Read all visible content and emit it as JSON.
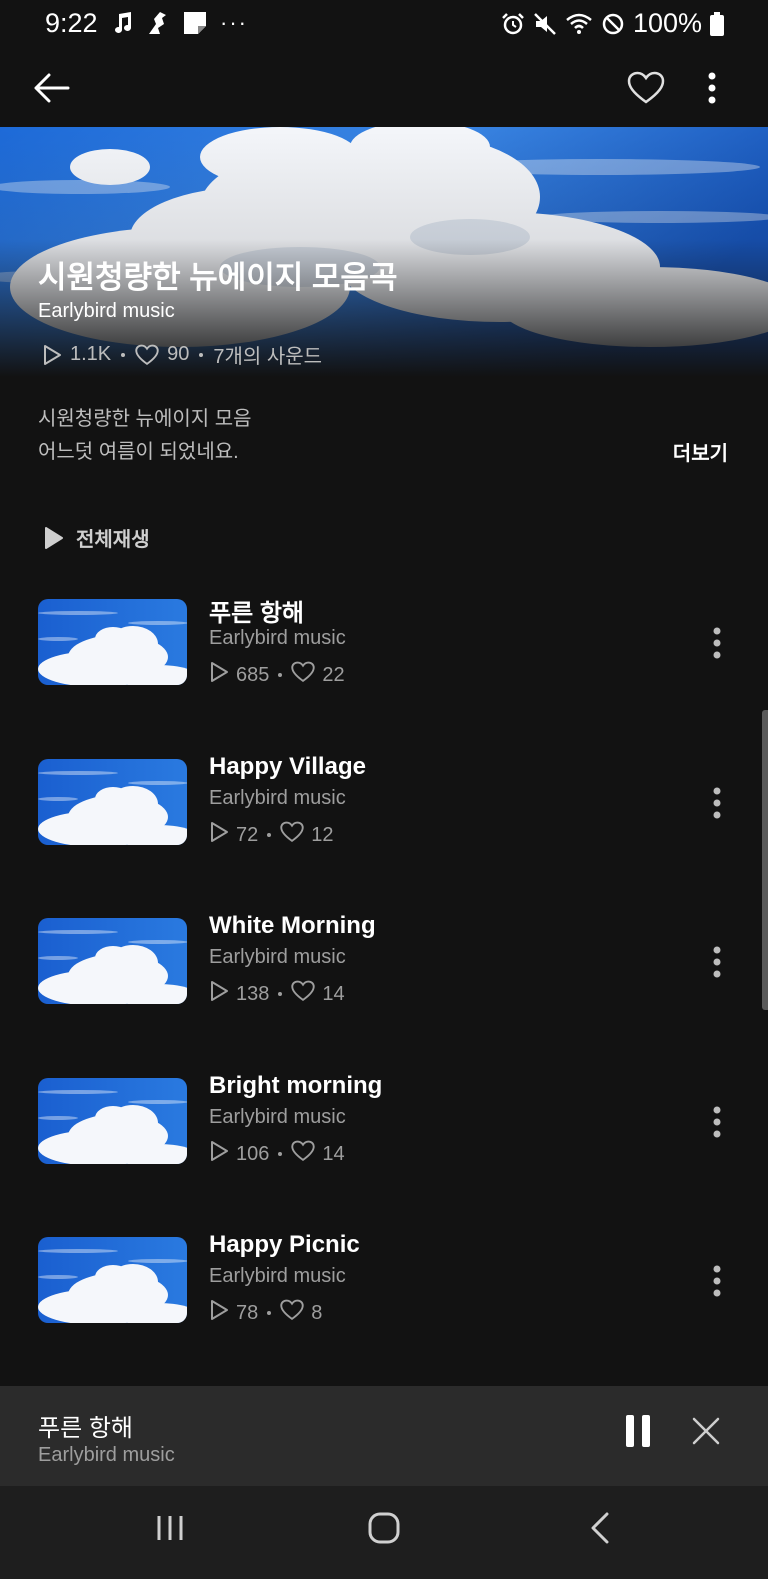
{
  "status_bar": {
    "time": "9:22",
    "battery": "100%"
  },
  "app_bar": {
    "icons": [
      "back-arrow-icon",
      "heart-icon",
      "more-vert-icon"
    ]
  },
  "playlist": {
    "title": "시원청량한 뉴에이지 모음곡",
    "artist": "Earlybird music",
    "plays": "1.1K",
    "likes": "90",
    "sounds": "7개의 사운드",
    "description_line1": "시원청량한 뉴에이지 모음",
    "description_line2": "어느덧 여름이 되었네요.",
    "more_label": "더보기",
    "play_all_label": "전체재생"
  },
  "tracks": [
    {
      "title": "푸른 항해",
      "artist": "Earlybird music",
      "plays": "685",
      "likes": "22"
    },
    {
      "title": "Happy Village",
      "artist": "Earlybird music",
      "plays": "72",
      "likes": "12"
    },
    {
      "title": "White Morning",
      "artist": "Earlybird music",
      "plays": "138",
      "likes": "14"
    },
    {
      "title": "Bright morning",
      "artist": "Earlybird music",
      "plays": "106",
      "likes": "14"
    },
    {
      "title": "Happy Picnic",
      "artist": "Earlybird music",
      "plays": "78",
      "likes": "8"
    }
  ],
  "mini_player": {
    "title": "푸른 항해",
    "artist": "Earlybird music"
  },
  "colors": {
    "background": "#121212",
    "mini_player": "#2b2b2b",
    "sky": "#1a5fc8"
  }
}
